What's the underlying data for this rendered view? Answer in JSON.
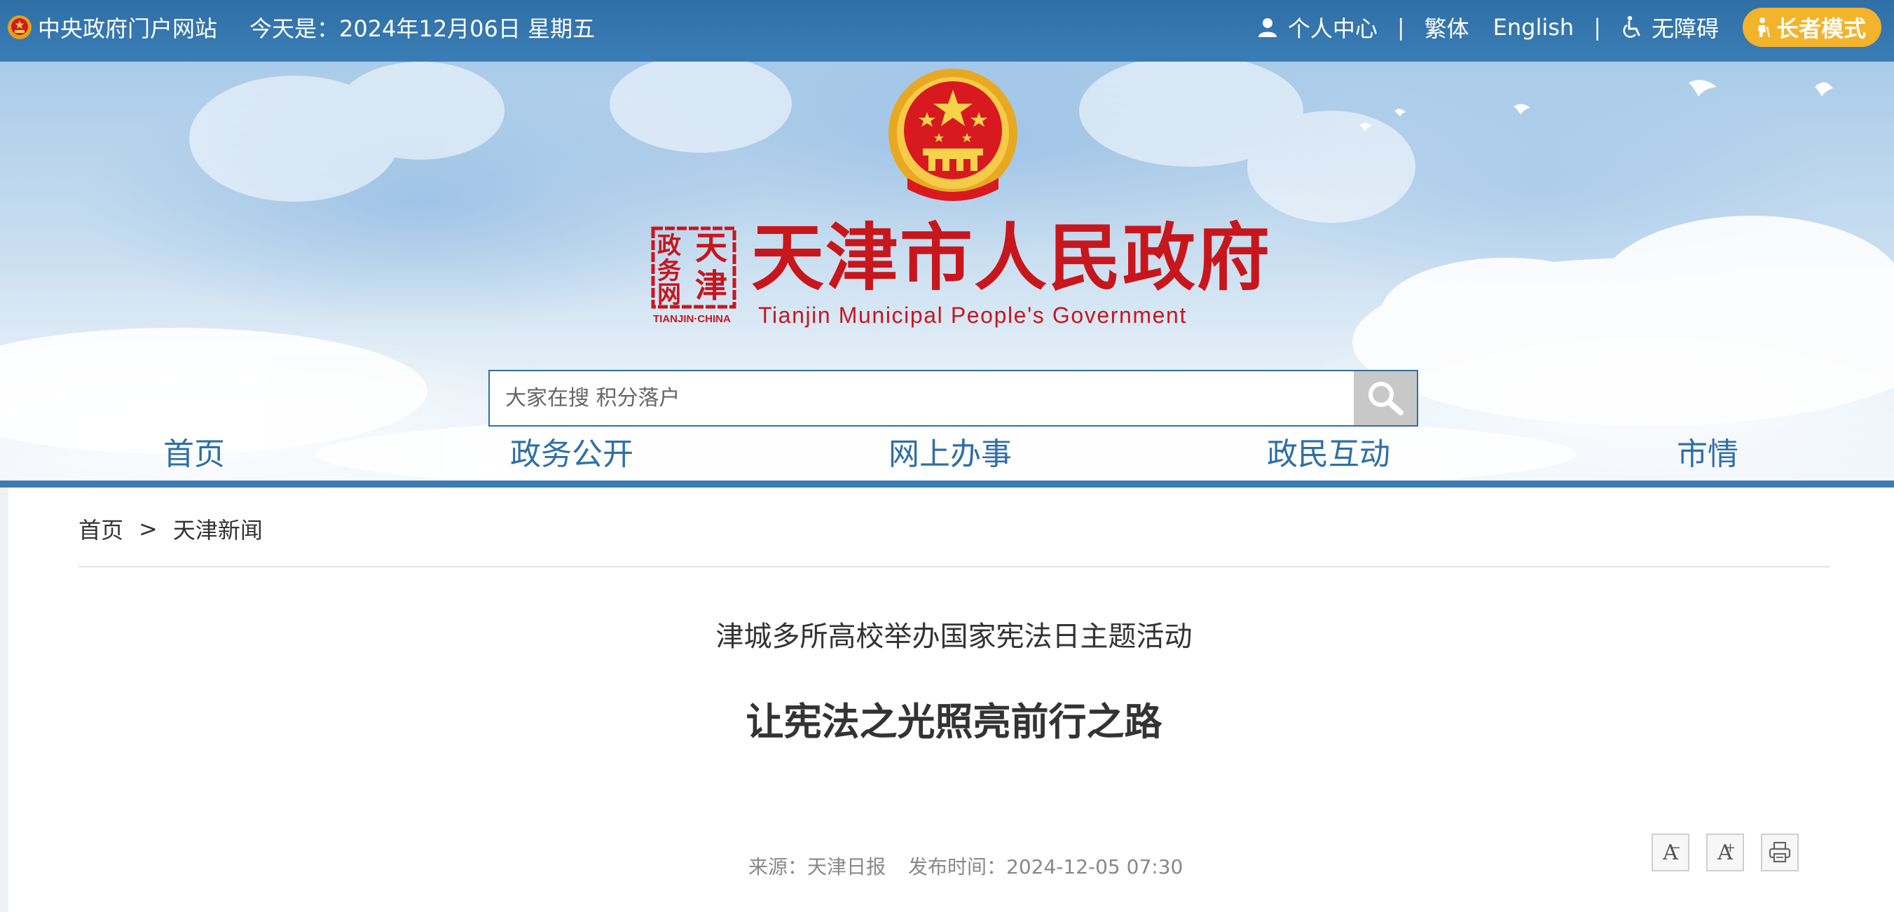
{
  "topbar": {
    "central_site": "中央政府门户网站",
    "date_text": "今天是：2024年12月06日 星期五",
    "personal_center": "个人中心",
    "separator": "|",
    "traditional": "繁体",
    "english": "English",
    "accessibility": "无障碍",
    "elder_mode": "长者模式"
  },
  "header": {
    "site_title": "天津市人民政府",
    "site_title_en": "Tianjin Municipal People's Government",
    "seal_caption": "TIANJIN·CHINA",
    "seal_text": [
      "政",
      "务",
      "网",
      "天",
      "津"
    ]
  },
  "search": {
    "placeholder": "大家在搜 积分落户"
  },
  "nav": {
    "items": [
      "首页",
      "政务公开",
      "网上办事",
      "政民互动",
      "市情"
    ]
  },
  "breadcrumb": {
    "home": "首页",
    "arrow": ">",
    "current": "天津新闻"
  },
  "article": {
    "subtitle": "津城多所高校举办国家宪法日主题活动",
    "title": "让宪法之光照亮前行之路",
    "source": "来源：天津日报",
    "published": "发布时间：2024-12-05 07:30"
  },
  "tools": {
    "font_decrease": "A",
    "font_decrease_mark": "−",
    "font_increase": "A",
    "font_increase_mark": "+"
  },
  "colors": {
    "topbar_blue": "#2f6fa6",
    "nav_blue": "#2f6fa6",
    "brand_red": "#c8161d",
    "elder_orange": "#f3b32a"
  }
}
